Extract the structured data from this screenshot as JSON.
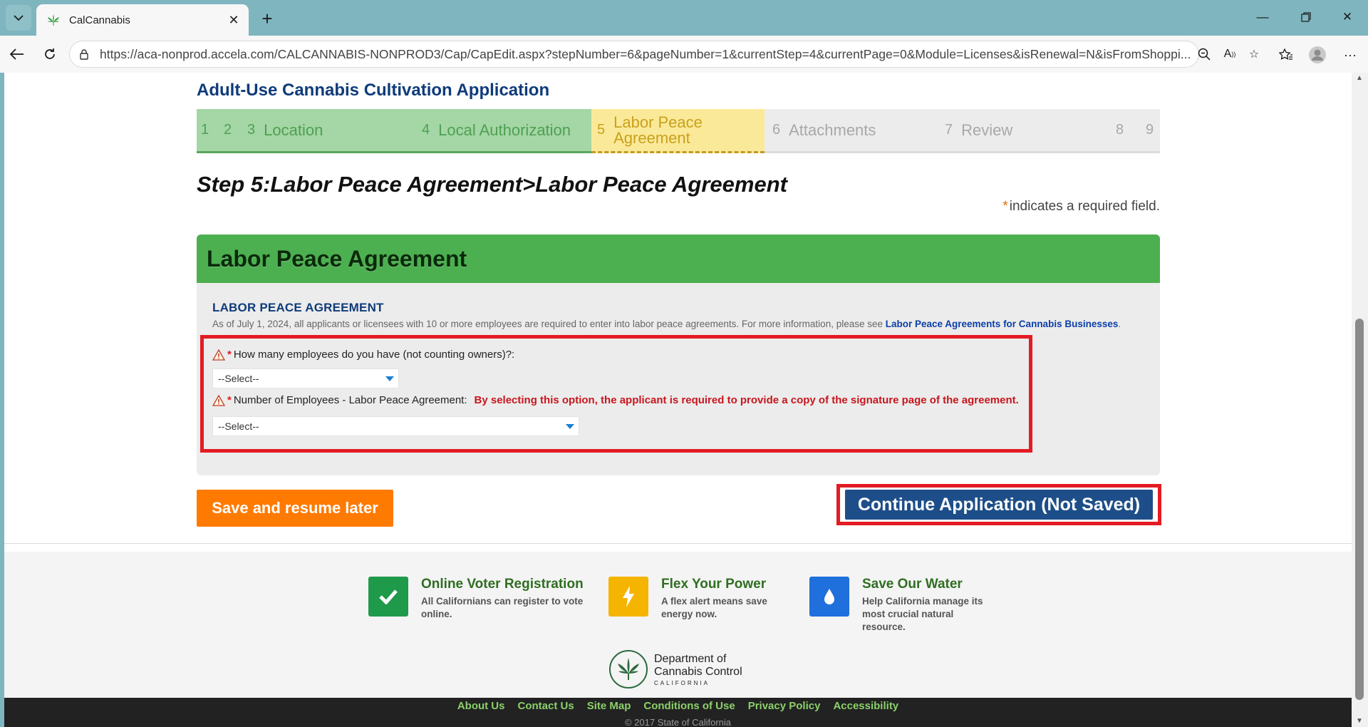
{
  "browser": {
    "tab_title": "CalCannabis",
    "url": "https://aca-nonprod.accela.com/CALCANNABIS-NONPROD3/Cap/CapEdit.aspx?stepNumber=6&pageNumber=1&currentStep=4&currentPage=0&Module=Licenses&isRenewal=N&isFromShoppi..."
  },
  "page": {
    "app_title": "Adult-Use Cannabis Cultivation Application",
    "steps": [
      {
        "num": "1",
        "label": "",
        "state": "done"
      },
      {
        "num": "2",
        "label": "",
        "state": "done"
      },
      {
        "num": "3",
        "label": "Location",
        "state": "done"
      },
      {
        "num": "4",
        "label": "Local Authorization",
        "state": "done"
      },
      {
        "num": "5",
        "label": "Labor Peace Agreement",
        "state": "current"
      },
      {
        "num": "6",
        "label": "Attachments",
        "state": "future"
      },
      {
        "num": "7",
        "label": "Review",
        "state": "future"
      },
      {
        "num": "8",
        "label": "",
        "state": "future"
      },
      {
        "num": "9",
        "label": "",
        "state": "future"
      }
    ],
    "step_heading": "Step 5:Labor Peace Agreement>Labor Peace Agreement",
    "required_star": "*",
    "required_note": "indicates a required field."
  },
  "panel": {
    "title": "Labor Peace Agreement",
    "section_title": "LABOR PEACE AGREEMENT",
    "description": "As of July 1, 2024, all applicants or licensees with 10 or more employees are required to enter into labor peace agreements. For more information, please see ",
    "description_link": "Labor Peace Agreements for Cannabis Businesses",
    "description_end": ".",
    "fields": [
      {
        "star": "*",
        "label": "How many employees do you have (not counting owners)?:",
        "value": "--Select--",
        "note": ""
      },
      {
        "star": "*",
        "label": "Number of Employees - Labor Peace Agreement:",
        "value": "--Select--",
        "note": "By selecting this option, the applicant is required to provide a copy of the signature page of the agreement."
      }
    ]
  },
  "buttons": {
    "save": "Save and resume later",
    "continue": "Continue Application (Not Saved)"
  },
  "footer": {
    "promos": [
      {
        "title": "Online Voter Registration",
        "desc": [
          "All Californians can register to vote",
          "online."
        ],
        "icon": "checkmark-icon",
        "color": "#1f9a4a"
      },
      {
        "title": "Flex Your Power",
        "desc": [
          "A flex alert means save",
          "energy now."
        ],
        "icon": "lightning-icon",
        "color": "#f5b400"
      },
      {
        "title": "Save Our Water",
        "desc": [
          "Help California manage its",
          "most crucial natural",
          "resource."
        ],
        "icon": "water-drop-icon",
        "color": "#1f6fdc"
      }
    ],
    "logo_line1": "Department of",
    "logo_line2": "Cannabis Control",
    "logo_line3": "CALIFORNIA",
    "links": [
      "About Us",
      "Contact Us",
      "Site Map",
      "Conditions of Use",
      "Privacy Policy",
      "Accessibility"
    ],
    "copyright": "© 2017 State of California"
  }
}
